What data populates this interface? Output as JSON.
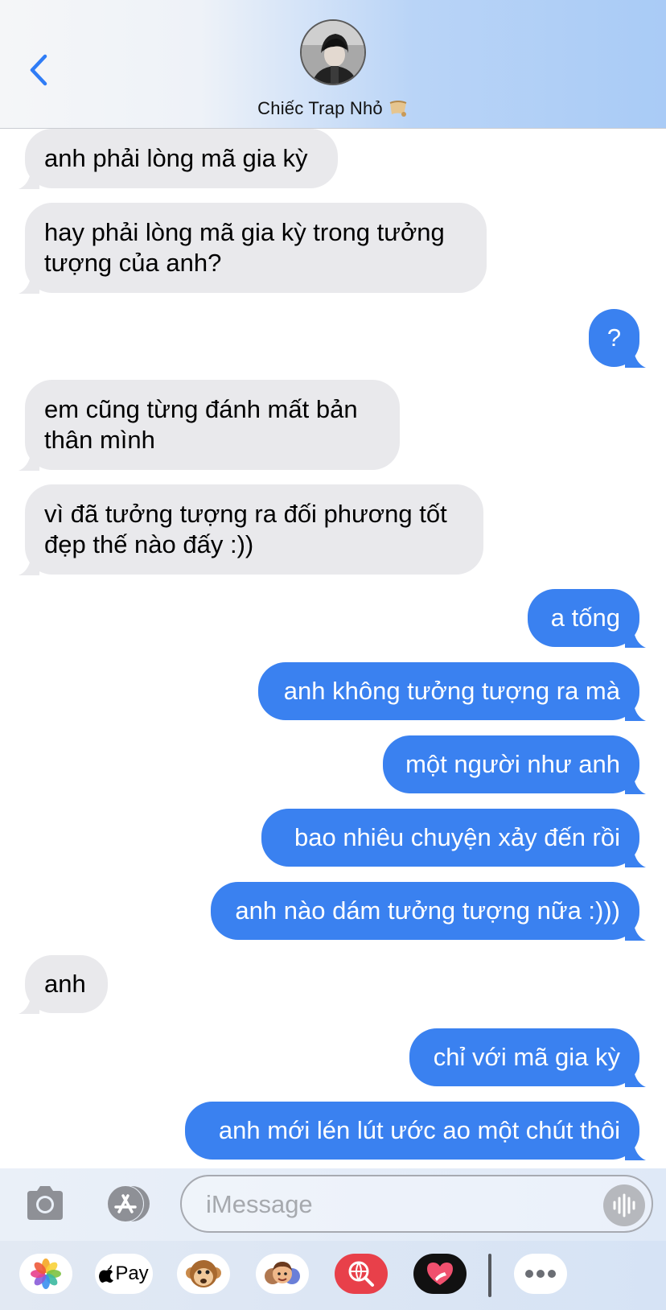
{
  "header": {
    "back_icon": "chevron-left-icon",
    "contact_name": "Chiếc Trap Nhỏ",
    "name_emoji_icon": "scroll-emoji-icon"
  },
  "colors": {
    "sent_bubble": "#3a81f0",
    "received_bubble": "#e9e9ec",
    "accent": "#2f7cf6"
  },
  "messages": [
    {
      "direction": "received",
      "text": "anh phải lòng mã gia kỳ"
    },
    {
      "direction": "received",
      "lines": [
        "hay phải lòng mã gia kỳ trong tưởng",
        "tượng của anh?"
      ]
    },
    {
      "direction": "sent",
      "text": "?"
    },
    {
      "direction": "received",
      "lines": [
        "em cũng từng đánh mất bản",
        "thân mình"
      ]
    },
    {
      "direction": "received",
      "lines": [
        "vì đã tưởng tượng ra đối phương tốt",
        "đẹp thế nào đấy :))"
      ]
    },
    {
      "direction": "sent",
      "text": "a tống"
    },
    {
      "direction": "sent",
      "text": "anh không tưởng tượng ra mà"
    },
    {
      "direction": "sent",
      "text": "một người như anh"
    },
    {
      "direction": "sent",
      "text": "bao nhiêu chuyện xảy đến rồi"
    },
    {
      "direction": "sent",
      "text": "anh nào dám tưởng tượng nữa :)))"
    },
    {
      "direction": "received",
      "text": "anh"
    },
    {
      "direction": "sent",
      "text": "chỉ với mã gia kỳ"
    },
    {
      "direction": "sent",
      "text": "anh mới lén lút ước ao một chút thôi"
    }
  ],
  "input": {
    "placeholder": "iMessage",
    "value": ""
  },
  "toolbar": {
    "camera_icon": "camera-icon",
    "apps_icon": "app-store-icon",
    "voice_icon": "audio-waveform-icon"
  },
  "app_drawer": {
    "apps": [
      {
        "name": "photos-app-icon"
      },
      {
        "name": "apple-pay-app",
        "label": "Pay"
      },
      {
        "name": "monkey-animoji-icon"
      },
      {
        "name": "memoji-stickers-icon"
      },
      {
        "name": "web-search-icon"
      },
      {
        "name": "digital-touch-heart-icon"
      },
      {
        "name": "more-apps-icon"
      }
    ]
  }
}
